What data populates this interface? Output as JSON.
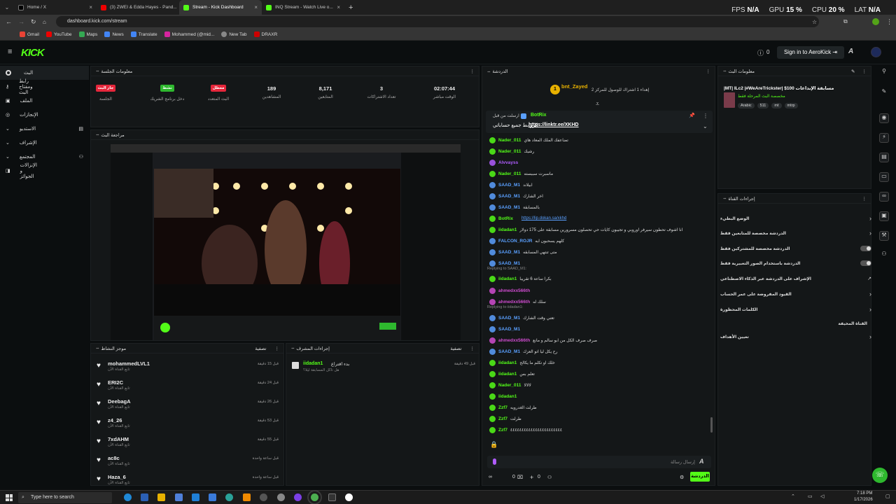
{
  "browser": {
    "tabs": [
      {
        "title": "Home / X"
      },
      {
        "title": "(3) ZWEI & Edda Hayes - Pand..."
      },
      {
        "title": "Stream - Kick Dashboard"
      },
      {
        "title": "INQ Stream - Watch Live o..."
      }
    ],
    "url": "dashboard.kick.com/stream",
    "bookmarks": [
      "Gmail",
      "YouTube",
      "Maps",
      "News",
      "Translate",
      "Mohammed (@mid...",
      "New Tab",
      "DRAXR"
    ],
    "perf": {
      "fps_label": "FPS",
      "fps": "N/A",
      "gpu_label": "GPU",
      "gpu": "15 %",
      "cpu_label": "CPU",
      "cpu": "20 %",
      "lat_label": "LAT",
      "lat": "N/A"
    }
  },
  "header": {
    "logo": "KICK",
    "notif_count": "0",
    "signin_label": "Sign in to AeroKick"
  },
  "sidebar": {
    "items": [
      "البث",
      "رابط ومفتاح البث",
      "الملف",
      "الإنجازات",
      "الاستديو",
      "الإشراف",
      "المجتمع",
      "الإنزالات و الجوائز"
    ]
  },
  "session": {
    "title": "معلومات الجلسة",
    "stats": [
      {
        "badge": "جار البث",
        "label": "الجلسة",
        "color": "#e5263b"
      },
      {
        "badge": "نشط",
        "label": "دخل برنامج الشريك",
        "color": "#2eb82e"
      },
      {
        "badge": "معطل",
        "label": "البث المتعدد",
        "color": "#e5263b"
      },
      {
        "value": "189",
        "label": "المشاهدين"
      },
      {
        "value": "8,171",
        "label": "المتابعين"
      },
      {
        "value": "3",
        "label": "تعداد الاشتراكات"
      },
      {
        "value": "02:07:44",
        "label": "الوقت مباشر"
      }
    ]
  },
  "preview": {
    "title": "مراجعة البث"
  },
  "followers": {
    "title": "موجز النشاط",
    "filter": "تصفية",
    "items": [
      {
        "name": "mohammedLVL1",
        "sub": "تابع القناة الآن",
        "time": "قبل 15 دقيقة"
      },
      {
        "name": "ERI2C",
        "sub": "تابع القناة الآن",
        "time": "قبل 24 دقيقة"
      },
      {
        "name": "DeebagA",
        "sub": "تابع القناة الآن",
        "time": "قبل 26 دقيقة"
      },
      {
        "name": "z4_26",
        "sub": "تابع القناة الآن",
        "time": "قبل 53 دقيقة"
      },
      {
        "name": "7xdAHM",
        "sub": "تابع القناة الآن",
        "time": "قبل 55 دقيقة"
      },
      {
        "name": "ac8c",
        "sub": "تابع القناة الآن",
        "time": "قبل ساعة واحدة"
      },
      {
        "name": "Haza_6",
        "sub": "تابع القناة الآن",
        "time": "قبل ساعة واحدة"
      }
    ]
  },
  "modactions": {
    "title": "إجراءات المشرف",
    "filter": "تصفية",
    "items": [
      {
        "name": "iidadan1",
        "text": "بدء اقتراع",
        "sub": "هل تاكل المسابقة ليلا؟",
        "time": "قبل 49 دقيقة"
      }
    ]
  },
  "chat": {
    "title": "الدردشة",
    "pinned_user": "bnt_Zayed",
    "pinned_text": "إهداء 1 اشتراك للوصول للمركز 2",
    "bot_name": "BotRix",
    "bot_text": "https://linktr.ee/XKHD",
    "bot_prefix": "الروابط جميع حساباتي",
    "pinned_by": "ارسلت من قبل",
    "messages": [
      {
        "user": "Nader_011",
        "text": "تضاعفك الملك المعاد هاي",
        "color": "#53fc18"
      },
      {
        "user": "Nader_011",
        "text": "رشيك",
        "color": "#53fc18"
      },
      {
        "user": "Alvvayss",
        "text": "",
        "color": "#b05cff"
      },
      {
        "user": "Nader_011",
        "text": "ماسبرت سببسته",
        "color": "#53fc18"
      },
      {
        "user": "SAAD_M1",
        "text": "ابيلاند",
        "color": "#5aa0ff"
      },
      {
        "user": "SAAD_M1",
        "text": "اخر الشارك",
        "color": "#5aa0ff"
      },
      {
        "user": "SAAD_M1",
        "text": "بالمسابقة",
        "color": "#5aa0ff"
      },
      {
        "user": "BotRix",
        "text": "https://lip.dokan.sa/xkhd",
        "color": "#53fc18"
      },
      {
        "user": "iidadan1",
        "text": "انا اشوف تحطون سيرفر اوروبي و تجيبون كايات حي تحصلون مسرورين مسابقة على 175 دولار",
        "color": "#53fc18"
      },
      {
        "user": "FALCON_ROJR",
        "text": "كلهم يسحبون ابه",
        "color": "#5aa0ff"
      },
      {
        "user": "SAAD_M1",
        "text": "متى تنتهي المسابقه",
        "color": "#5aa0ff"
      },
      {
        "user": "SAAD_M1",
        "text": "",
        "color": "#5aa0ff"
      },
      {
        "user": "iidadan1",
        "text": "بكرا ساعة 6 تقريبا",
        "color": "#53fc18"
      },
      {
        "user": "ahmedxx566th",
        "text": "",
        "color": "#d04cd0"
      },
      {
        "user": "ahmedxx566th",
        "text": "سلك له",
        "color": "#d04cd0"
      },
      {
        "user": "SAAD_M1",
        "text": "تعني وقت الشارك",
        "color": "#5aa0ff"
      },
      {
        "user": "SAAD_M1",
        "text": "",
        "color": "#5aa0ff"
      },
      {
        "user": "ahmedxx566th",
        "text": "صرف صرف الكل من ابو سالم و مانع",
        "color": "#d04cd0"
      },
      {
        "user": "SAAD_M1",
        "text": "رح يكل ليا اتو العزك",
        "color": "#5aa0ff"
      },
      {
        "user": "iidadan1",
        "text": "خلك او تكلم ما يكالح",
        "color": "#53fc18"
      },
      {
        "user": "iidadan1",
        "text": "تعلم بس",
        "color": "#53fc18"
      },
      {
        "user": "Nader_011",
        "text": "لالالا",
        "color": "#53fc18"
      },
      {
        "user": "iidadan1",
        "text": "",
        "color": "#53fc18"
      },
      {
        "user": "Zzf7",
        "text": "طرلت الغدرويه",
        "color": "#53fc18"
      },
      {
        "user": "Zzf7",
        "text": "طرلت",
        "color": "#53fc18"
      },
      {
        "user": "Zzf7",
        "text": "٤٤٤٤٤٤٤٤٤٤٤٤٤٤٤٤٤٤٤٤٤٤٤",
        "color": "#53fc18"
      }
    ],
    "replies": [
      "Replying to SAAD_M1:",
      "Replying to iidadan1:"
    ],
    "input_placeholder": "إرسال رسالة",
    "send_label": "الدردشة",
    "footer_count1": "0",
    "footer_count2": "0"
  },
  "streaminfo": {
    "title": "معلومات البث",
    "stream_title": "|MT| ILc2 |#WeAreTrickster| $100 مسابقة الإبداعات",
    "category": "مخصصة البث المرحلة فقط",
    "tags": [
      "Arabic",
      "511",
      "mt",
      "mtrp"
    ]
  },
  "chatactions": {
    "title": "إجراءات القناة",
    "items": [
      {
        "label": "الوضع البطيء",
        "type": "chevron"
      },
      {
        "label": "الدردشة مخصصة للمتابعين فقط",
        "type": "chevron"
      },
      {
        "label": "الدردشة مخصصة للمشتركين فقط",
        "type": "toggle"
      },
      {
        "label": "الدردشة باستخدام الصور التعبيرية فقط",
        "type": "toggle"
      },
      {
        "label": "الإشراف على الدردشة عبر الذكاء الاصطناعي",
        "type": "link"
      },
      {
        "label": "القيود المفروضة على عمر الحساب",
        "type": "chevron"
      },
      {
        "label": "الكلمات المحظورة",
        "type": "chevron"
      },
      {
        "label": "القناة المخيفة",
        "type": "text"
      },
      {
        "label": "تعيين الأهداف",
        "type": "chevron"
      }
    ]
  },
  "taskbar": {
    "search_placeholder": "Type here to search",
    "time": "7:18 PM",
    "date": "1/17/2026"
  },
  "colors": {
    "brand": "#53fc18",
    "bg": "#0b0e0f",
    "panel": "#141718"
  }
}
